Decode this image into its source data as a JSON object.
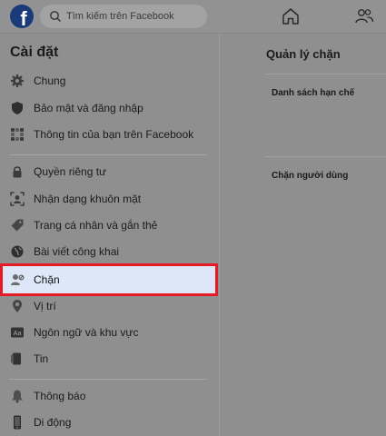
{
  "header": {
    "logo_letter": "f",
    "search": {
      "placeholder": "Tìm kiếm trên Facebook"
    },
    "icons": [
      "search-icon",
      "home-icon",
      "friends-icon"
    ]
  },
  "sidebar": {
    "title": "Cài đặt",
    "items": [
      {
        "label": "Chung",
        "icon": "gear-icon"
      },
      {
        "label": "Bảo mật và đăng nhập",
        "icon": "shield-icon"
      },
      {
        "label": "Thông tin của bạn trên Facebook",
        "icon": "grid-icon"
      },
      {
        "label": "Quyền riêng tư",
        "icon": "lock-icon"
      },
      {
        "label": "Nhận dạng khuôn mặt",
        "icon": "face-recognition-icon"
      },
      {
        "label": "Trang cá nhân và gắn thẻ",
        "icon": "tag-icon"
      },
      {
        "label": "Bài viết công khai",
        "icon": "globe-icon"
      },
      {
        "label": "Chặn",
        "icon": "block-user-icon",
        "selected": true
      },
      {
        "label": "Vị trí",
        "icon": "location-pin-icon"
      },
      {
        "label": "Ngôn ngữ và khu vực",
        "icon": "language-icon"
      },
      {
        "label": "Tin",
        "icon": "story-icon"
      },
      {
        "label": "Thông báo",
        "icon": "bell-icon"
      },
      {
        "label": "Di động",
        "icon": "mobile-icon"
      }
    ]
  },
  "main": {
    "title": "Quản lý chặn",
    "sections": [
      {
        "label": "Danh sách hạn chế"
      },
      {
        "label": "Chặn người dùng"
      }
    ]
  },
  "colors": {
    "background": "#8f8f8f",
    "selected_bg": "#dde7f7",
    "highlight_border": "#e51b24",
    "logo": "#1b3a7a"
  }
}
